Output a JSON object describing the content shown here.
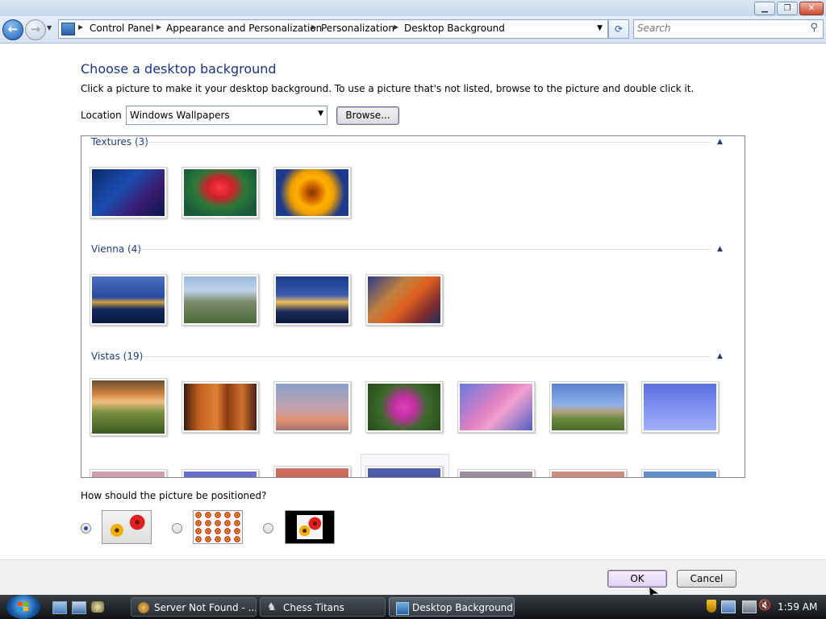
{
  "window": {
    "minimize_glyph": "▁",
    "maximize_glyph": "❐",
    "close_glyph": "✕"
  },
  "nav": {
    "back_glyph": "←",
    "forward_glyph": "→",
    "recent_glyph": "▼",
    "breadcrumbs": [
      "Control Panel",
      "Appearance and Personalization",
      "Personalization",
      "Desktop Background"
    ],
    "address_dropdown_glyph": "▼",
    "refresh_glyph": "⟳",
    "search_placeholder": "Search",
    "search_icon": "magnifier-icon"
  },
  "page": {
    "heading": "Choose a desktop background",
    "instructions": "Click a picture to make it your desktop background. To use a picture that's not listed, browse to the picture and double click it.",
    "location_label": "Location",
    "location_value": "Windows Wallpapers",
    "browse_label": "Browse..."
  },
  "gallery": {
    "groups": [
      {
        "label": "Textures (3)",
        "collapse_glyph": "▲",
        "thumbs": [
          {
            "name": "texture-dark-lights",
            "bg": "linear-gradient(135deg,#0a2a6a 0%,#1b4db0 40%,#3a1a70 70%,#0a1a4a 100%)"
          },
          {
            "name": "texture-red-flower",
            "bg": "radial-gradient(ellipse at 50% 40%,#ff3a40 0%,#d0202a 25%,#2a7a3a 50%,#1a5a3a 80%)"
          },
          {
            "name": "texture-sunflower",
            "bg": "radial-gradient(circle at 50% 50%,#7a3a00 0%,#c85800 15%,#ffb000 35%,#f0a000 50%,#1e3a8a 75%)"
          }
        ]
      },
      {
        "label": "Vienna (4)",
        "collapse_glyph": "▲",
        "thumbs": [
          {
            "name": "vienna-palace-night",
            "bg": "linear-gradient(#4a70c0 0%,#2a4aa0 45%,#d0a040 55%,#102a60 70%,#0a1a40 100%)"
          },
          {
            "name": "vienna-city-aerial",
            "bg": "linear-gradient(#9ab8e0 0%,#c0d4ea 30%,#7a8a6a 55%,#4a6a3a 100%)"
          },
          {
            "name": "vienna-church-night",
            "bg": "linear-gradient(#1a3a8a 0%,#3a5ab0 40%,#f0c060 55%,#1a2a5a 75%,#0a1a3a 100%)"
          },
          {
            "name": "vienna-autumn-trees",
            "bg": "linear-gradient(135deg,#2a3a8a 0%,#c08040 35%,#e06020 55%,#7a2a30 80%,#203060 100%)"
          }
        ]
      },
      {
        "label": "Vistas (19)",
        "collapse_glyph": "▲",
        "thumbs": [
          {
            "name": "vista-sunset-tree",
            "bg": "linear-gradient(#6a5030 0%,#d08040 25%,#f0c080 40%,#7a9040 60%,#3a5a20 100%)"
          },
          {
            "name": "vista-window-sunset",
            "bg": "linear-gradient(90deg,#3a1a10 0%,#c06020 20%,#e08030 45%,#8a3a10 60%,#d07030 80%,#4a2010 100%)"
          },
          {
            "name": "vista-bare-branches",
            "bg": "linear-gradient(#8aa0c8 0%,#c0a0b0 50%,#e09070 80%,#a07070 100%)"
          },
          {
            "name": "vista-purple-flowers",
            "bg": "radial-gradient(circle at 50% 50%,#e040c0 0%,#c030a0 25%,#3a6a2a 55%,#2a4a1a 100%)"
          },
          {
            "name": "vista-pink-clouds",
            "bg": "linear-gradient(135deg,#6a7ae0 0%,#e080c0 45%,#f0a0d0 60%,#5060c0 100%)"
          },
          {
            "name": "vista-green-hill-sky",
            "bg": "linear-gradient(#5a80d0 0%,#90b0e8 45%,#b0a080 60%,#6a8a40 75%,#4a6a2a 100%)"
          },
          {
            "name": "vista-branch-blue-sky",
            "bg": "linear-gradient(#5a70e0 0%,#8090f0 50%,#a0b0f8 100%)"
          }
        ],
        "partial_thumbs": [
          {
            "name": "vista-partial-1",
            "bg": "linear-gradient(#d0a0b0,#c090a0)"
          },
          {
            "name": "vista-partial-2",
            "bg": "linear-gradient(#6a70d0,#5060c0)"
          },
          {
            "name": "vista-partial-3",
            "bg": "linear-gradient(#d07060,#a04030)"
          },
          {
            "name": "vista-partial-4",
            "bg": "linear-gradient(#5060b0,#303a80)"
          },
          {
            "name": "vista-partial-5",
            "bg": "linear-gradient(#a090a0,#706070)"
          },
          {
            "name": "vista-partial-6",
            "bg": "linear-gradient(#d09080,#b07060)"
          },
          {
            "name": "vista-partial-7",
            "bg": "linear-gradient(#6090d0,#4070b0)"
          }
        ]
      }
    ],
    "scroll_up_glyph": "▲",
    "scroll_down_glyph": "▼",
    "scroll_grip_glyph": "≡"
  },
  "position": {
    "label": "How should the picture be positioned?",
    "options": [
      {
        "name": "position-fill",
        "selected": true
      },
      {
        "name": "position-tile",
        "selected": false
      },
      {
        "name": "position-center",
        "selected": false
      }
    ]
  },
  "footer": {
    "ok_label": "OK",
    "cancel_label": "Cancel"
  },
  "taskbar": {
    "start_icon": "windows-orb-icon",
    "quick_launch": [
      "show-desktop-icon",
      "switch-windows-icon",
      "game-icon"
    ],
    "tasks": [
      {
        "label": "Server Not Found - ...",
        "active": false
      },
      {
        "label": "Chess Titans",
        "active": false
      },
      {
        "label": "Desktop Background",
        "active": true
      }
    ],
    "tray_icons": [
      "security-shield-icon",
      "network-icon",
      "volume-muted-icon"
    ],
    "clock": "1:59 AM"
  },
  "cursor_glyph": "➤"
}
